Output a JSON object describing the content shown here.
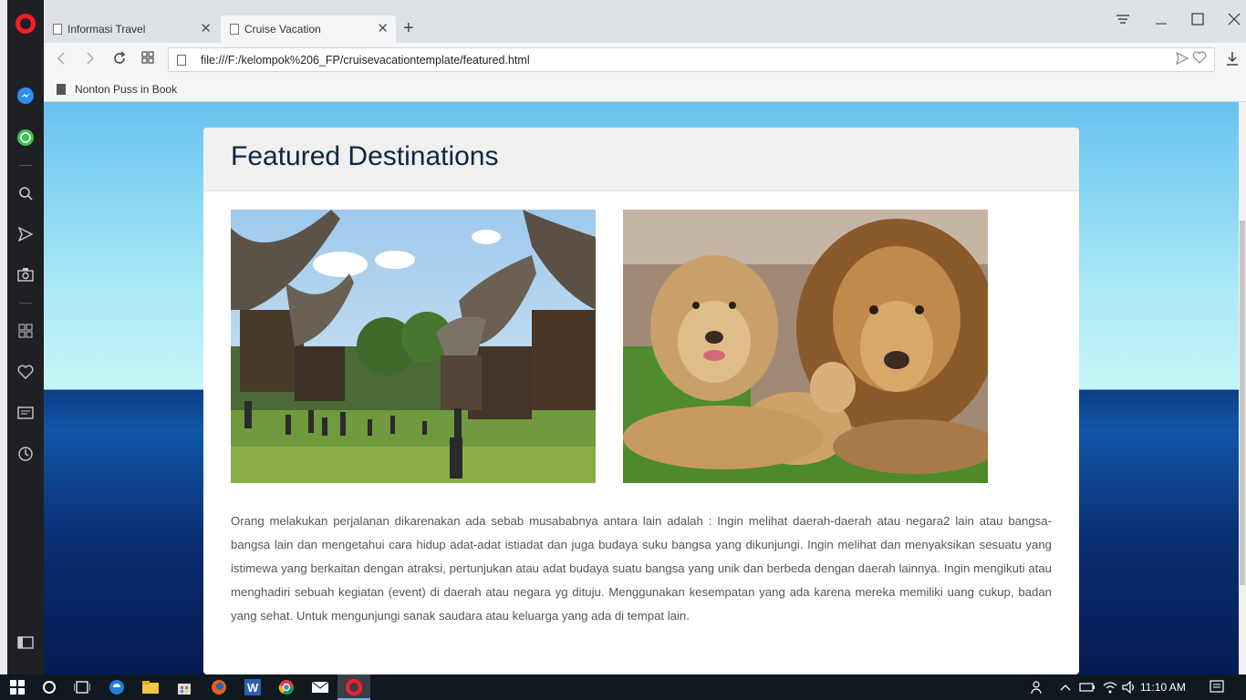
{
  "browser": {
    "tabs": [
      {
        "label": "Informasi Travel",
        "active": false
      },
      {
        "label": "Cruise Vacation",
        "active": true
      }
    ],
    "url": "file:///F:/kelompok%206_FP/cruisevacationtemplate/featured.html",
    "bookmarks": [
      {
        "label": "Nonton Puss in Book"
      }
    ],
    "sidebar_icons": [
      "messenger-icon",
      "whatsapp-icon",
      "search-icon",
      "send-icon",
      "camera-icon",
      "grid-icon",
      "heart-icon",
      "news-icon",
      "history-icon",
      "sidebar-toggle-icon"
    ]
  },
  "page": {
    "heading": "Featured Destinations",
    "images": [
      {
        "alt_icon": "toraja-village-photo"
      },
      {
        "alt_icon": "lions-photo"
      }
    ],
    "description": "Orang melakukan perjalanan dikarenakan ada sebab musababnya antara lain adalah : Ingin melihat daerah-daerah atau negara2 lain atau bangsa-bangsa lain dan mengetahui cara hidup adat-adat istiadat dan juga budaya suku bangsa yang dikunjungi. Ingin melihat dan menyaksikan sesuatu yang istimewa yang berkaitan dengan atraksi, pertunjukan atau adat budaya suatu bangsa yang unik dan berbeda dengan daerah lainnya. Ingin mengikuti atau menghadiri sebuah kegiatan (event) di daerah atau negara yg dituju. Menggunakan kesempatan yang ada karena mereka memiliki uang cukup, badan yang sehat. Untuk mengunjungi sanak saudara atau keluarga yang ada di tempat lain."
  },
  "taskbar": {
    "clock": "11:10 AM"
  },
  "colors": {
    "heading": "#0e2645",
    "opera_red": "#ff1b2d",
    "taskbar": "#101820"
  }
}
